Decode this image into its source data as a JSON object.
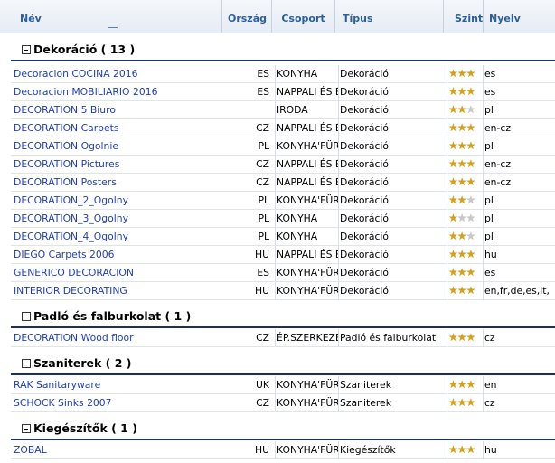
{
  "columns": {
    "nev": "Név",
    "orszag": "Ország",
    "csoport": "Csoport",
    "tipus": "Típus",
    "szint": "Szint",
    "nyelv": "Nyelv"
  },
  "groups": [
    {
      "title": "Dekoráció ( 13 )",
      "rows": [
        {
          "name": "Decoracion COCINA 2016",
          "country": "ES",
          "group": "KONYHA",
          "type": "Dekoráció",
          "stars": 3,
          "lang": "es"
        },
        {
          "name": "Decoracion MOBILIARIO 2016",
          "country": "ES",
          "group": "NAPPALI ÉS É",
          "type": "Dekoráció",
          "stars": 3,
          "lang": "es"
        },
        {
          "name": "DECORATION 5 Biuro",
          "country": "",
          "group": "IRODA",
          "type": "Dekoráció",
          "stars": 2,
          "lang": "pl"
        },
        {
          "name": "DECORATION Carpets",
          "country": "CZ",
          "group": "NAPPALI ÉS É",
          "type": "Dekoráció",
          "stars": 3,
          "lang": "en-cz"
        },
        {
          "name": "DECORATION Ogolnie",
          "country": "PL",
          "group": "KONYHA'FÜRI",
          "type": "Dekoráció",
          "stars": 3,
          "lang": "pl"
        },
        {
          "name": "DECORATION Pictures",
          "country": "CZ",
          "group": "NAPPALI ÉS É",
          "type": "Dekoráció",
          "stars": 3,
          "lang": "en-cz"
        },
        {
          "name": "DECORATION Posters",
          "country": "CZ",
          "group": "NAPPALI ÉS É",
          "type": "Dekoráció",
          "stars": 3,
          "lang": "en-cz"
        },
        {
          "name": "DECORATION_2_Ogolny",
          "country": "PL",
          "group": "KONYHA'FÜRI",
          "type": "Dekoráció",
          "stars": 2,
          "lang": "pl"
        },
        {
          "name": "DECORATION_3_Ogolny",
          "country": "PL",
          "group": "KONYHA",
          "type": "Dekoráció",
          "stars": 1,
          "lang": "pl"
        },
        {
          "name": "DECORATION_4_Ogolny",
          "country": "PL",
          "group": "KONYHA",
          "type": "Dekoráció",
          "stars": 2,
          "lang": "pl"
        },
        {
          "name": "DIEGO Carpets 2006",
          "country": "HU",
          "group": "NAPPALI ÉS É",
          "type": "Dekoráció",
          "stars": 3,
          "lang": "hu"
        },
        {
          "name": "GENERICO DECORACION",
          "country": "ES",
          "group": "KONYHA'FÜRI",
          "type": "Dekoráció",
          "stars": 3,
          "lang": "es"
        },
        {
          "name": "INTERIOR DECORATING",
          "country": "HU",
          "group": "KONYHA'FÜRI",
          "type": "Dekoráció",
          "stars": 3,
          "lang": "en,fr,de,es,it,"
        }
      ]
    },
    {
      "title": "Padló és falburkolat ( 1 )",
      "rows": [
        {
          "name": "DECORATION Wood floor",
          "country": "CZ",
          "group": "ÉP.SZERKEZE",
          "type": "Padló és falburkolat",
          "stars": 3,
          "lang": "cz"
        }
      ]
    },
    {
      "title": "Szaniterek ( 2 )",
      "rows": [
        {
          "name": "RAK Sanitaryware",
          "country": "UK",
          "group": "KONYHA'FÜRI",
          "type": "Szaniterek",
          "stars": 3,
          "lang": "en"
        },
        {
          "name": "SCHOCK Sinks 2007",
          "country": "CZ",
          "group": "KONYHA'FÜRI",
          "type": "Szaniterek",
          "stars": 3,
          "lang": "cz"
        }
      ]
    },
    {
      "title": "Kiegészítők ( 1 )",
      "rows": [
        {
          "name": "ZOBAL",
          "country": "HU",
          "group": "KONYHA'FÜRI",
          "type": "Kiegészítők",
          "stars": 3,
          "lang": "hu"
        }
      ]
    }
  ],
  "icons": {
    "collapse": "minus-box-icon",
    "rating": "star-icon"
  },
  "colors": {
    "header_text": "#2b5f9a",
    "link": "#1f3db8",
    "group_line": "#1d2f6b",
    "star_on": "#d9a010",
    "star_off": "#c8c8c8"
  }
}
